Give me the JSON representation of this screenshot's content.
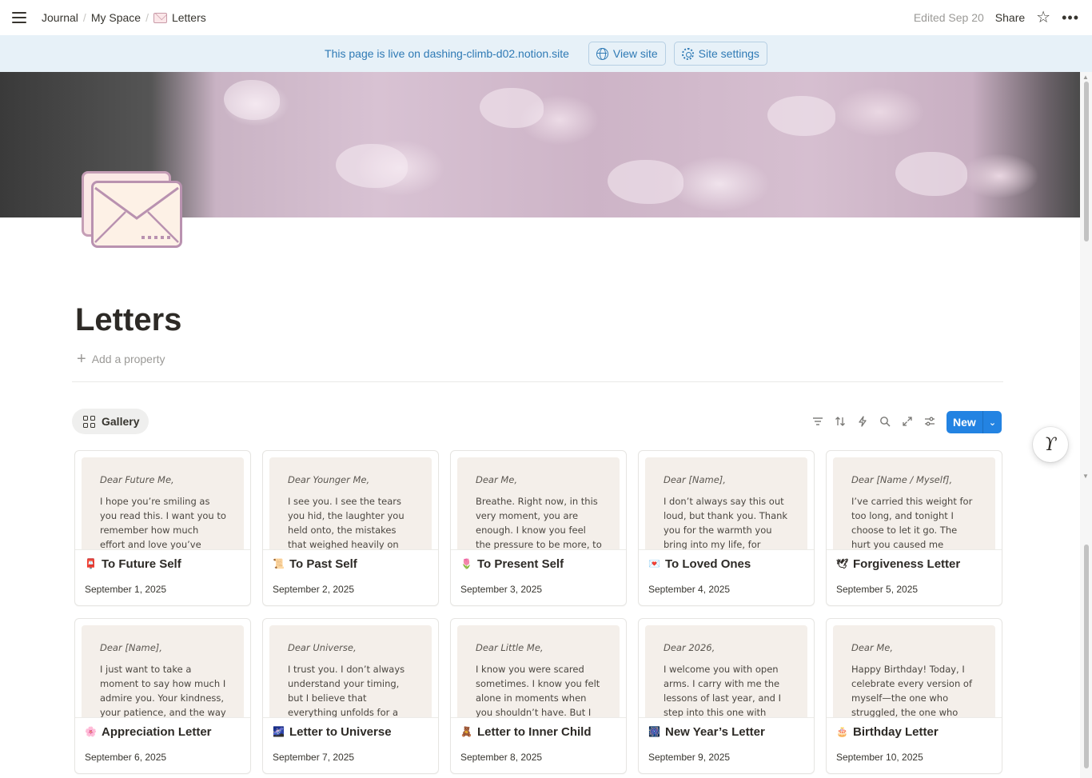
{
  "breadcrumbs": [
    "Journal",
    "My Space",
    "Letters"
  ],
  "topbar": {
    "edited": "Edited Sep 20",
    "share": "Share"
  },
  "banner": {
    "text": "This page is live on dashing-climb-d02.notion.site",
    "view_site": "View site",
    "site_settings": "Site settings"
  },
  "page": {
    "title": "Letters",
    "add_property": "Add a property"
  },
  "view": {
    "tab": "Gallery",
    "new_label": "New"
  },
  "colors": {
    "accent": "#2383e2",
    "banner_bg": "#e7f1f8",
    "banner_text": "#2f7ab5"
  },
  "cards": [
    {
      "salutation": "Dear Future Me,",
      "body": "I hope you’re smiling as you read this. I want you to remember how much effort and love you’ve poured into",
      "icon": "mailbox-icon",
      "emoji": "📮",
      "title": "To Future Self",
      "date": "September 1, 2025"
    },
    {
      "salutation": "Dear Younger Me,",
      "body": "I see you. I see the tears you hid, the laughter you held onto, the mistakes that weighed heavily on you. But",
      "icon": "scroll-icon",
      "emoji": "📜",
      "title": "To Past Self",
      "date": "September 2, 2025"
    },
    {
      "salutation": "Dear Me,",
      "body": "Breathe. Right now, in this very moment, you are enough. I know you feel the pressure to be more, to do",
      "icon": "tulip-icon",
      "emoji": "🌷",
      "title": "To Present Self",
      "date": "September 3, 2025"
    },
    {
      "salutation": "Dear [Name],",
      "body": "I don’t always say this out loud, but thank you. Thank you for the warmth you bring into my life, for",
      "icon": "love-letter-icon",
      "emoji": "💌",
      "title": "To Loved Ones",
      "date": "September 4, 2025"
    },
    {
      "salutation": "Dear [Name / Myself],",
      "body": "I’ve carried this weight for too long, and tonight I choose to let it go. The hurt you caused me shaped me,",
      "icon": "dove-icon",
      "emoji": "🕊",
      "title": "Forgiveness Letter",
      "date": "September 5, 2025"
    },
    {
      "salutation": "Dear [Name],",
      "body": "I just want to take a moment to say how much I admire you. Your kindness, your patience, and the way you",
      "icon": "blossom-icon",
      "emoji": "🌸",
      "title": "Appreciation Letter",
      "date": "September 6, 2025"
    },
    {
      "salutation": "Dear Universe,",
      "body": "I trust you. I don’t always understand your timing, but I believe that everything unfolds for a reason. I open",
      "icon": "galaxy-icon",
      "emoji": "🌌",
      "title": "Letter to Universe",
      "date": "September 7, 2025"
    },
    {
      "salutation": "Dear Little Me,",
      "body": "I know you were scared sometimes. I know you felt alone in moments when you shouldn’t have. But I want",
      "icon": "teddy-bear-icon",
      "emoji": "🧸",
      "title": "Letter to Inner Child",
      "date": "September 8, 2025"
    },
    {
      "salutation": "Dear 2026,",
      "body": "I welcome you with open arms. I carry with me the lessons of last year, and I step into this one with hope,",
      "icon": "fireworks-icon",
      "emoji": "🎆",
      "title": "New Year’s Letter",
      "date": "September 9, 2025"
    },
    {
      "salutation": "Dear Me,",
      "body": "Happy Birthday! Today, I celebrate every version of myself—the one who struggled, the one who",
      "icon": "cake-icon",
      "emoji": "🎂",
      "title": "Birthday Letter",
      "date": "September 10, 2025"
    }
  ]
}
